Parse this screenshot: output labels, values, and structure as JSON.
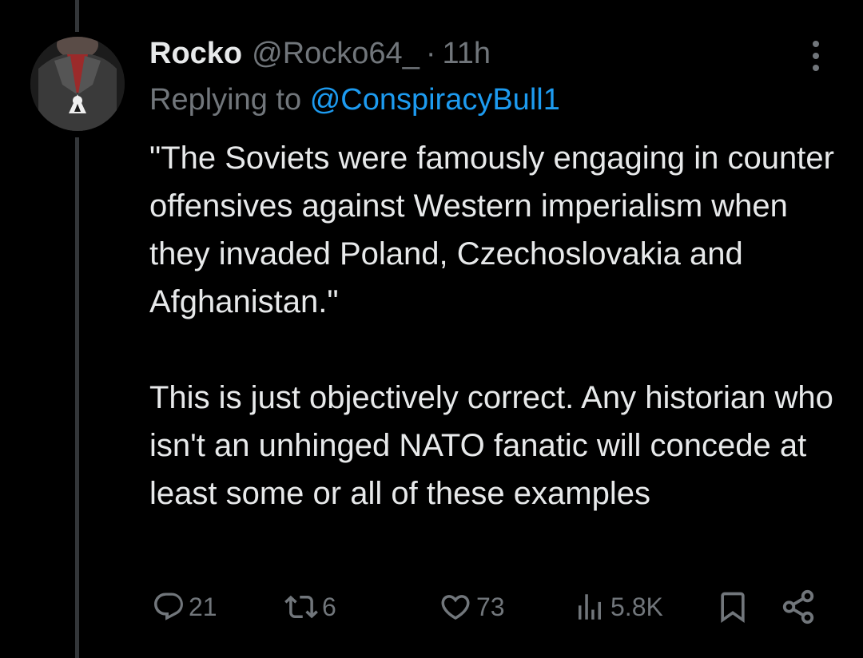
{
  "tweet": {
    "author_name": "Rocko",
    "author_handle": "@Rocko64_",
    "separator": "·",
    "time": "11h",
    "replying_prefix": "Replying to",
    "replying_to": "@ConspiracyBull1",
    "text": "\"The Soviets were famously engaging in counter offensives against Western imperialism when they invaded Poland, Czechoslovakia and Afghanistan.\"\n\nThis is just objectively correct. Any historian who isn't an unhinged NATO fanatic will concede at least some or all of these examples"
  },
  "actions": {
    "replies": "21",
    "reposts": "6",
    "likes": "73",
    "views": "5.8K"
  },
  "icons": {
    "reply": "reply-icon",
    "repost": "repost-icon",
    "like": "heart-icon",
    "views": "views-icon",
    "bookmark": "bookmark-icon",
    "share": "share-icon",
    "more": "more-icon"
  },
  "colors": {
    "background": "#000000",
    "text": "#e7e9ea",
    "secondary": "#71767b",
    "link": "#1d9bf0"
  }
}
